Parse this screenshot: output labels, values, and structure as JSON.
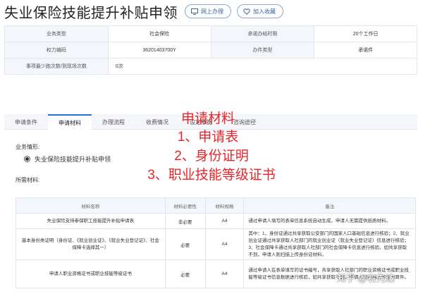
{
  "header": {
    "title": "失业保险技能提升补贴申领",
    "online_btn": "网上办理",
    "fav_btn": "加入收藏"
  },
  "info": {
    "rows": [
      [
        {
          "k": "业务类型",
          "v": "社会保险"
        },
        {
          "k": "承诺办结时限",
          "v": "20个工作日"
        }
      ],
      [
        {
          "k": "权力编码",
          "v": "36201403700Y"
        },
        {
          "k": "办件类型",
          "v": "承诺件"
        }
      ],
      [
        {
          "k": "事项最少跑次数/到现场次数",
          "v": "0次"
        }
      ]
    ]
  },
  "tabs": [
    "申请条件",
    "申请材料",
    "办理流程",
    "收费情况",
    "设定依据",
    "咨询途径"
  ],
  "active_tab": 1,
  "annotation": {
    "line1": "申请材料",
    "line2": "1、申请表",
    "line3": "2、身份证明",
    "line4": "3、职业技能等级证书"
  },
  "scenario": {
    "label": "业务情形:",
    "option": "失业保险技能提升补贴申领"
  },
  "materials": {
    "label": "所需材料:",
    "headers": [
      "材料名称",
      "材料必要性",
      "材料规格",
      "备注"
    ],
    "rows": [
      {
        "name": "失业保险支持参保职工技能提升补贴申请表",
        "necessity": "非必要",
        "spec": "A4",
        "remark": "通过申请人填写的表单信息系统自动生成，申请人无需提供纸质材料。"
      },
      {
        "name": "基本身份类证明（身份证、《就业创业证》、《就业失业登记证》、社会保障卡选择其一）",
        "necessity": "必要",
        "spec": "A4",
        "remark": "其中：1、身份证通过共享获取公安部门的国家人口基础信息进行核验；2、就业创业证通过共享获取人社部门的就业创业证（就业失业登记证）信息进行核验；3、社会保障卡通过共享获取人社部门的社会保障卡信息进行核验。如共享获取不到，申请人则扫描上传身份证材料。"
      },
      {
        "name": "申请人职业资格证书或职业技能等级证书",
        "necessity": "必要",
        "spec": "A4",
        "remark": "通过申请人在表单填写的证书编号，共享获取人社部门的职业资格证书或职业技能等级证书信息数据进行核验，如共享获取不到，申请人则扫描上传证书原件。"
      }
    ]
  },
  "watermark": "知乎 @右先达",
  "colors": {
    "accent": "#2b6fd6",
    "annotation": "#e8252a",
    "header_cell": "#f3f6fa"
  }
}
